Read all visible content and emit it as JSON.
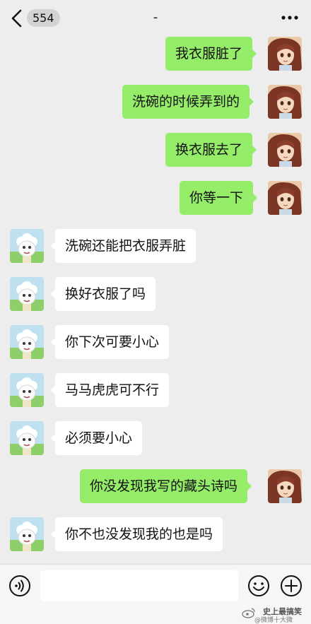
{
  "header": {
    "badge": "554",
    "title": "-"
  },
  "messages": [
    {
      "side": "out",
      "text": "我衣服脏了"
    },
    {
      "side": "out",
      "text": "洗碗的时候弄到的"
    },
    {
      "side": "out",
      "text": "换衣服去了"
    },
    {
      "side": "out",
      "text": "你等一下"
    },
    {
      "side": "in",
      "text": "洗碗还能把衣服弄脏"
    },
    {
      "side": "in",
      "text": "换好衣服了吗"
    },
    {
      "side": "in",
      "text": "你下次可要小心"
    },
    {
      "side": "in",
      "text": "马马虎虎可不行"
    },
    {
      "side": "in",
      "text": "必须要小心"
    },
    {
      "side": "out",
      "text": "你没发现我写的藏头诗吗"
    },
    {
      "side": "in",
      "text": "你不也没发现我的也是吗"
    }
  ],
  "input": {
    "value": ""
  },
  "watermark": {
    "line1": "史上最搞笑",
    "line2": "@微博十大微"
  },
  "icons": {
    "back": "chevron-left-icon",
    "more": "more-dots-icon",
    "voice": "voice-icon",
    "emoji": "emoji-icon",
    "plus": "plus-icon",
    "girl_avatar": "girl-avatar",
    "sheep_avatar": "sheep-avatar"
  },
  "colors": {
    "outgoing_bubble": "#95ec69",
    "incoming_bubble": "#ffffff",
    "background": "#ededed"
  }
}
